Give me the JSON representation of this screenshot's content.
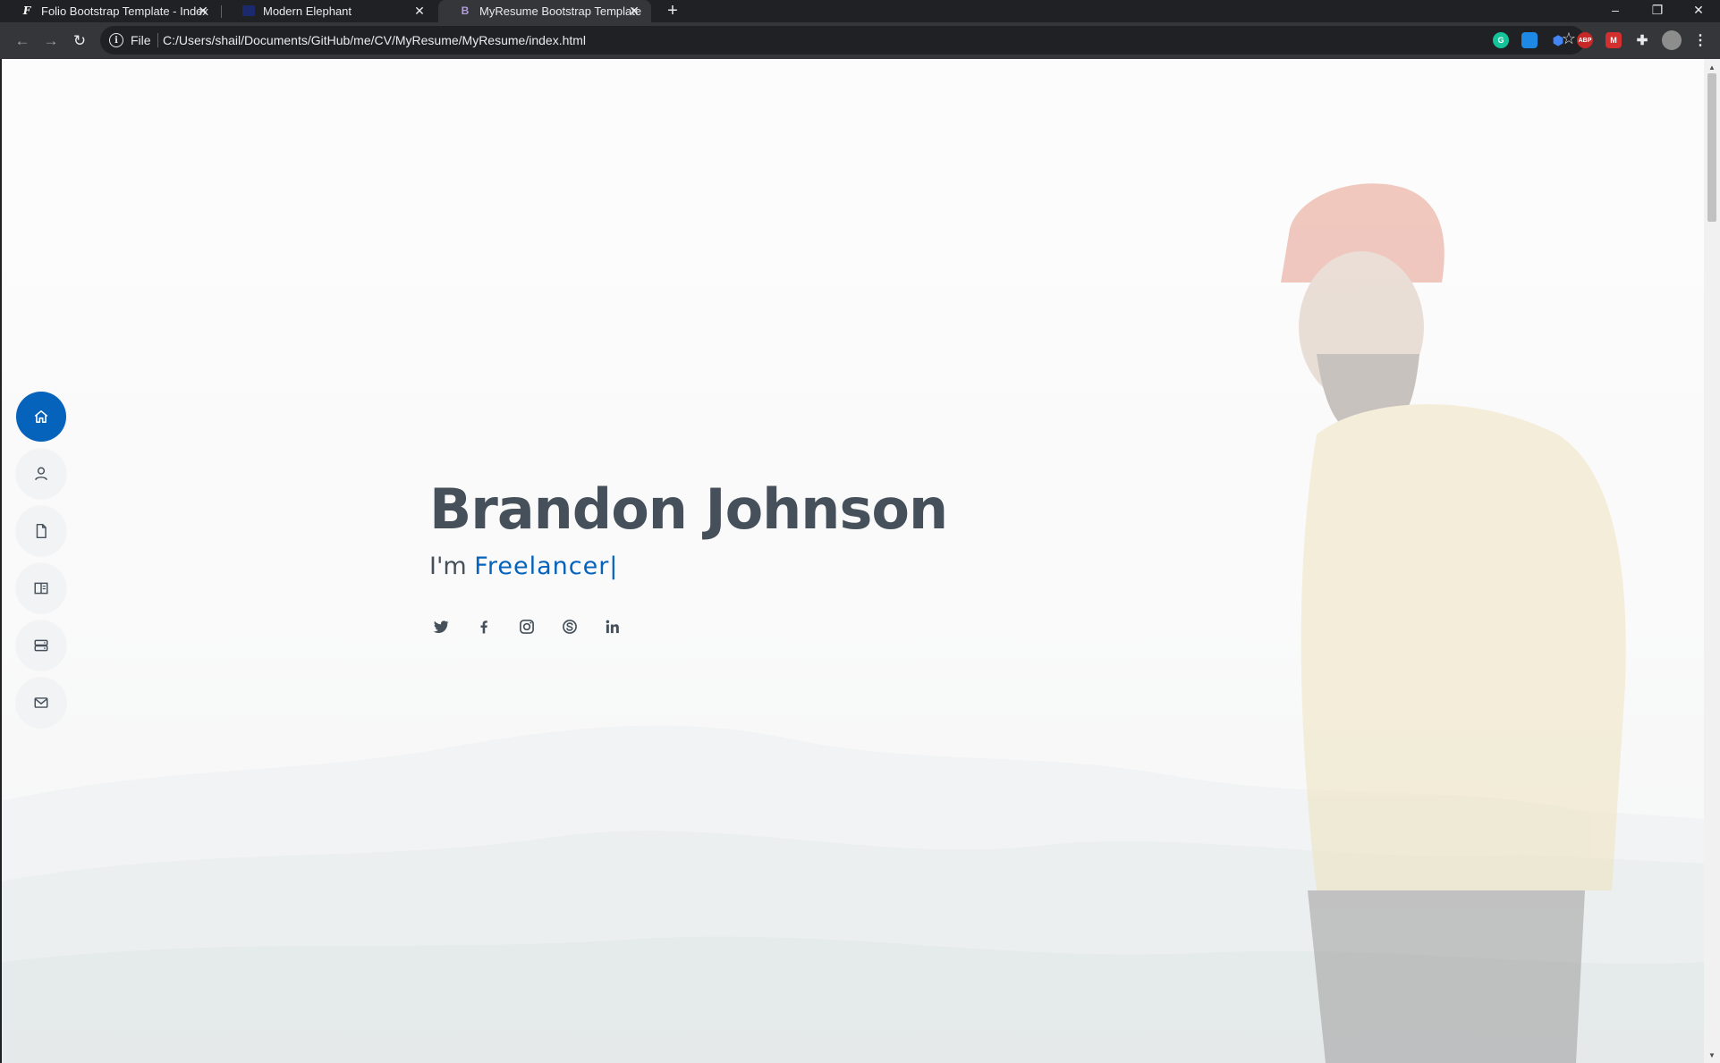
{
  "browser": {
    "tabs": [
      {
        "title": "Folio Bootstrap Template - Index",
        "favicon": "F",
        "active": false
      },
      {
        "title": "Modern Elephant",
        "favicon": "",
        "active": false
      },
      {
        "title": "MyResume Bootstrap Template -",
        "favicon": "B",
        "active": true
      }
    ],
    "new_tab_label": "+",
    "address": {
      "scheme_label": "File",
      "url": "C:/Users/shail/Documents/GitHub/me/CV/MyResume/MyResume/index.html"
    },
    "extensions": [
      "grammarly-icon",
      "screen-capture-icon",
      "bookmark-ext-icon",
      "adblock-icon",
      "mcafee-icon",
      "puzzle-icon"
    ],
    "extension_badges": {
      "grammarly": "G",
      "adblock": "ABP",
      "mcafee": "M"
    }
  },
  "sidenav": {
    "items": [
      {
        "icon": "home-icon",
        "active": true
      },
      {
        "icon": "person-icon",
        "active": false
      },
      {
        "icon": "file-icon",
        "active": false
      },
      {
        "icon": "book-icon",
        "active": false
      },
      {
        "icon": "server-icon",
        "active": false
      },
      {
        "icon": "envelope-icon",
        "active": false
      }
    ]
  },
  "hero": {
    "name": "Brandon Johnson",
    "prefix": "I'm",
    "typed": "Freelancer",
    "cursor": "|",
    "socials": [
      "twitter-icon",
      "facebook-icon",
      "instagram-icon",
      "skype-icon",
      "linkedin-icon"
    ]
  },
  "colors": {
    "accent": "#0563bb",
    "heading": "#45505b",
    "nav_bg": "#f2f3f5"
  }
}
